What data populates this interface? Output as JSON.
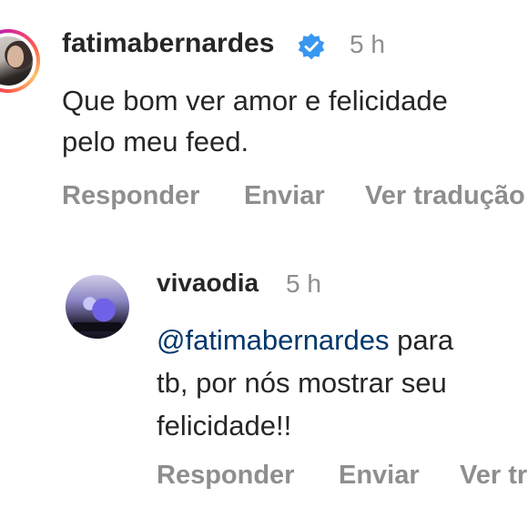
{
  "comment": {
    "username": "fatimabernardes",
    "time": "5 h",
    "lines": [
      "Que bom ver amor e felicidade",
      "pelo meu feed."
    ],
    "actions": {
      "reply": "Responder",
      "send": "Enviar",
      "translate": "Ver tradução"
    }
  },
  "reply": {
    "username": "vivaodia",
    "time": "5 h",
    "mention": "@fatimabernardes",
    "line1_rest": " para",
    "lines": [
      "tb, por nós mostrar seu",
      "felicidade!!"
    ],
    "actions": {
      "reply": "Responder",
      "send": "Enviar",
      "translate": "Ver tr"
    }
  },
  "colors": {
    "verified_badge": "#3897f0",
    "mention": "#00376b",
    "secondary_text": "#8e8e8e",
    "primary_text": "#262626"
  },
  "icons": {
    "verified": "verified-badge-icon"
  }
}
